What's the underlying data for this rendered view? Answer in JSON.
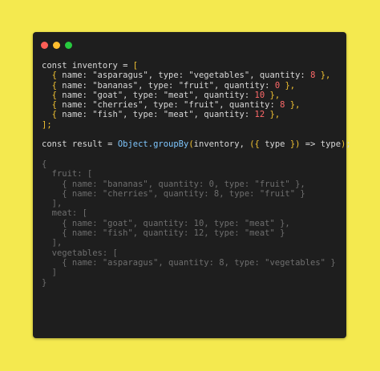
{
  "window": {
    "controls": {
      "close_color": "#ff5f56",
      "minimize_color": "#ffbd2e",
      "maximize_color": "#27c93f"
    }
  },
  "code": {
    "l1": [
      "const inventory = ",
      "["
    ],
    "items": [
      {
        "pre": "  ",
        "ob": "{",
        "mid": " name: \"asparagus\", type: \"vegetables\", quantity: ",
        "num": "8",
        "cb": " },",
        "close": "}"
      },
      {
        "pre": "  ",
        "ob": "{",
        "mid": " name: \"bananas\", type: \"fruit\", quantity: ",
        "num": "0",
        "cb": " },",
        "close": "}"
      },
      {
        "pre": "  ",
        "ob": "{",
        "mid": " name: \"goat\", type: \"meat\", quantity: ",
        "num": "10",
        "cb": " },",
        "close": "}"
      },
      {
        "pre": "  ",
        "ob": "{",
        "mid": " name: \"cherries\", type: \"fruit\", quantity: ",
        "num": "8",
        "cb": " },",
        "close": "}"
      },
      {
        "pre": "  ",
        "ob": "{",
        "mid": " name: \"fish\", type: \"meat\", quantity: ",
        "num": "12",
        "cb": " },",
        "close": "}"
      }
    ],
    "l7": "];",
    "result": {
      "a": "const result = ",
      "fn": "Object.groupBy",
      "p1": "(",
      "b": "inventory, ",
      "p2": "(",
      "c": "{",
      "d": " type ",
      "e": "}",
      "f": ")",
      "g": " => type",
      "h": ")",
      "i": ";"
    },
    "output": [
      "{",
      "  fruit: [",
      "    { name: \"bananas\", quantity: 0, type: \"fruit\" },",
      "    { name: \"cherries\", quantity: 8, type: \"fruit\" }",
      "  ],",
      "  meat: [",
      "    { name: \"goat\", quantity: 10, type: \"meat\" },",
      "    { name: \"fish\", quantity: 12, type: \"meat\" }",
      "  ],",
      "  vegetables: [",
      "    { name: \"asparagus\", quantity: 8, type: \"vegetables\" }",
      "  ]",
      "}"
    ]
  }
}
